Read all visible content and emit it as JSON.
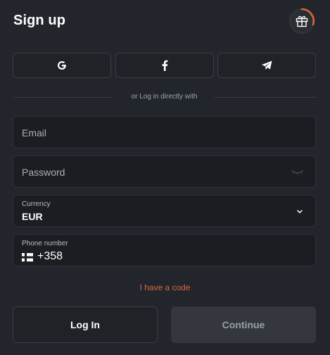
{
  "header": {
    "title": "Sign up",
    "gift_icon": "gift-icon"
  },
  "social": [
    {
      "name": "google",
      "icon": "google-icon"
    },
    {
      "name": "facebook",
      "icon": "facebook-icon"
    },
    {
      "name": "telegram",
      "icon": "telegram-icon"
    }
  ],
  "divider_text": "or Log in directly with",
  "form": {
    "email_placeholder": "Email",
    "password_placeholder": "Password",
    "currency_label": "Currency",
    "currency_value": "EUR",
    "phone_label": "Phone number",
    "phone_value": "+358"
  },
  "code_link": "I have a code",
  "buttons": {
    "login": "Log In",
    "continue": "Continue"
  },
  "colors": {
    "accent": "#e0653a",
    "background": "#22252c"
  }
}
